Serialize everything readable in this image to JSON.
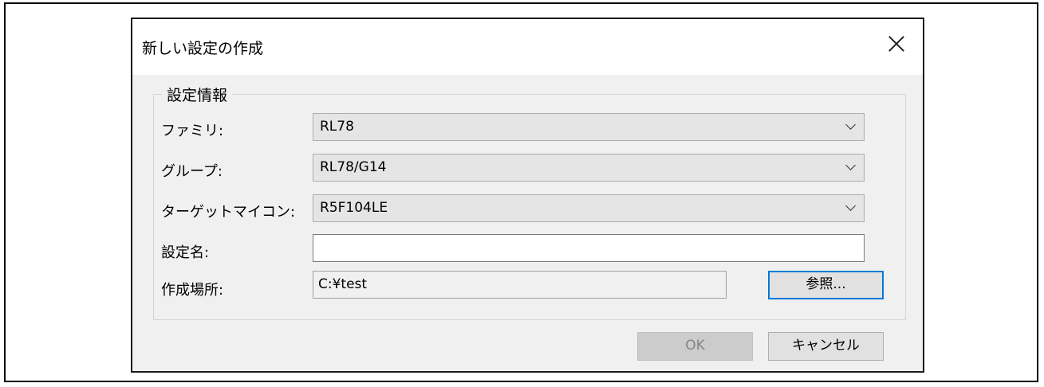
{
  "dialog": {
    "title": "新しい設定の作成",
    "group_title": "設定情報",
    "fields": {
      "family": {
        "label": "ファミリ:",
        "value": "RL78"
      },
      "group": {
        "label": "グループ:",
        "value": "RL78/G14"
      },
      "target": {
        "label": "ターゲットマイコン:",
        "value": "R5F104LE"
      },
      "name": {
        "label": "設定名:",
        "value": ""
      },
      "location": {
        "label": "作成場所:",
        "value": "C:¥test",
        "browse": "参照..."
      }
    },
    "buttons": {
      "ok": "OK",
      "cancel": "キャンセル"
    }
  }
}
